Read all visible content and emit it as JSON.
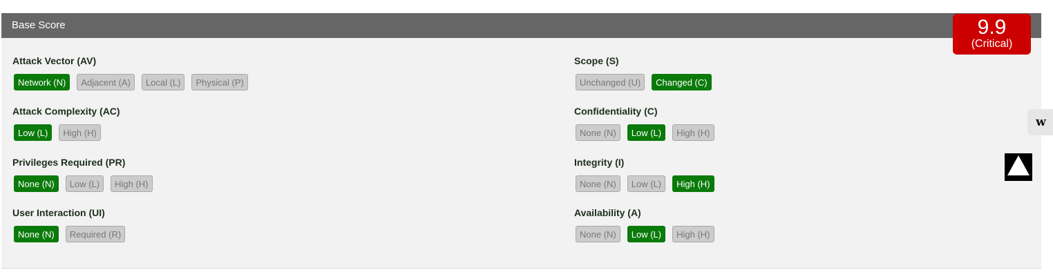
{
  "header": {
    "title": "Base Score"
  },
  "score": {
    "value": "9.9",
    "severity": "(Critical)",
    "color": "#cc0000"
  },
  "colors": {
    "selected": "#0a7a0a",
    "unselected": "#cccccc",
    "header": "#666666"
  },
  "metrics": {
    "av": {
      "title": "Attack Vector (AV)",
      "options": [
        "Network (N)",
        "Adjacent (A)",
        "Local (L)",
        "Physical (P)"
      ],
      "selected": "Network (N)"
    },
    "ac": {
      "title": "Attack Complexity (AC)",
      "options": [
        "Low (L)",
        "High (H)"
      ],
      "selected": "Low (L)"
    },
    "pr": {
      "title": "Privileges Required (PR)",
      "options": [
        "None (N)",
        "Low (L)",
        "High (H)"
      ],
      "selected": "None (N)"
    },
    "ui": {
      "title": "User Interaction (UI)",
      "options": [
        "None (N)",
        "Required (R)"
      ],
      "selected": "None (N)"
    },
    "s": {
      "title": "Scope (S)",
      "options": [
        "Unchanged (U)",
        "Changed (C)"
      ],
      "selected": "Changed (C)"
    },
    "c": {
      "title": "Confidentiality (C)",
      "options": [
        "None (N)",
        "Low (L)",
        "High (H)"
      ],
      "selected": "Low (L)"
    },
    "i": {
      "title": "Integrity (I)",
      "options": [
        "None (N)",
        "Low (L)",
        "High (H)"
      ],
      "selected": "High (H)"
    },
    "a": {
      "title": "Availability (A)",
      "options": [
        "None (N)",
        "Low (L)",
        "High (H)"
      ],
      "selected": "Low (L)"
    }
  },
  "side_widget": {
    "label": "w",
    "icon": "w-logo-icon"
  },
  "scroll_top": {
    "icon": "arrow-up-icon"
  }
}
